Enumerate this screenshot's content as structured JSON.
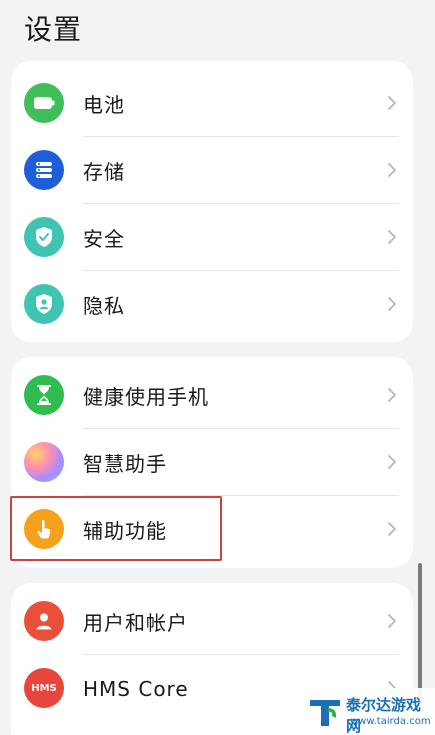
{
  "page": {
    "title": "设置"
  },
  "group1": {
    "items": [
      {
        "label": "电池",
        "icon": "battery-icon",
        "color": "#3fbf5a"
      },
      {
        "label": "存储",
        "icon": "storage-icon",
        "color": "#1e5fd9"
      },
      {
        "label": "安全",
        "icon": "security-shield-icon",
        "color": "#3fc4b2"
      },
      {
        "label": "隐私",
        "icon": "privacy-icon",
        "color": "#3fc4b2"
      }
    ]
  },
  "group2": {
    "items": [
      {
        "label": "健康使用手机",
        "icon": "hourglass-icon",
        "color": "#2fbd4f"
      },
      {
        "label": "智慧助手",
        "icon": "assistant-orb-icon",
        "color": "#c78fe6"
      },
      {
        "label": "辅助功能",
        "icon": "accessibility-hand-icon",
        "color": "#f4a11b"
      }
    ]
  },
  "group3": {
    "items": [
      {
        "label": "用户和帐户",
        "icon": "user-account-icon",
        "color": "#e8503a"
      },
      {
        "label": "HMS Core",
        "icon": "hms-core-icon",
        "color": "#e8453c",
        "badge": "HMS"
      }
    ]
  },
  "watermark": {
    "name": "泰尔达游戏网",
    "url": "www.tairda.com"
  }
}
